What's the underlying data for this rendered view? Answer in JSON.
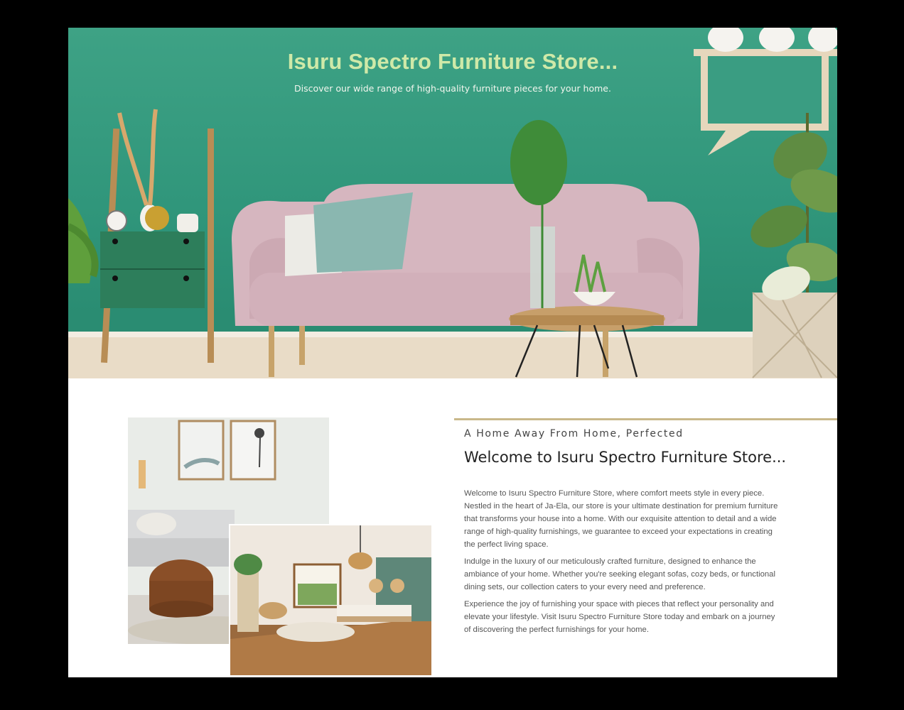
{
  "hero": {
    "title": "Isuru Spectro Furniture Store...",
    "subtitle": "Discover our wide range of high-quality furniture pieces for your home."
  },
  "about": {
    "kicker": "A Home Away From Home, Perfected",
    "heading": "Welcome to Isuru Spectro Furniture Store...",
    "paragraphs": [
      "Welcome to Isuru Spectro Furniture Store, where comfort meets style in every piece. Nestled in the heart of Ja-Ela, our store is your ultimate destination for premium furniture that transforms your house into a home. With our exquisite attention to detail and a wide range of high-quality furnishings, we guarantee to exceed your expectations in creating the perfect living space.",
      "Indulge in the luxury of our meticulously crafted furniture, designed to enhance the ambiance of your home. Whether you're seeking elegant sofas, cozy beds, or functional dining sets, our collection caters to your every need and preference.",
      "Experience the joy of furnishing your space with pieces that reflect your personality and elevate your lifestyle. Visit Isuru Spectro Furniture Store today and embark on a journey of discovering the perfect furnishings for your home."
    ]
  },
  "colors": {
    "wall_green": "#3ea285",
    "title_green": "#cfe9a8",
    "accent_gold": "#c9b88a",
    "page_bg": "#000000"
  }
}
